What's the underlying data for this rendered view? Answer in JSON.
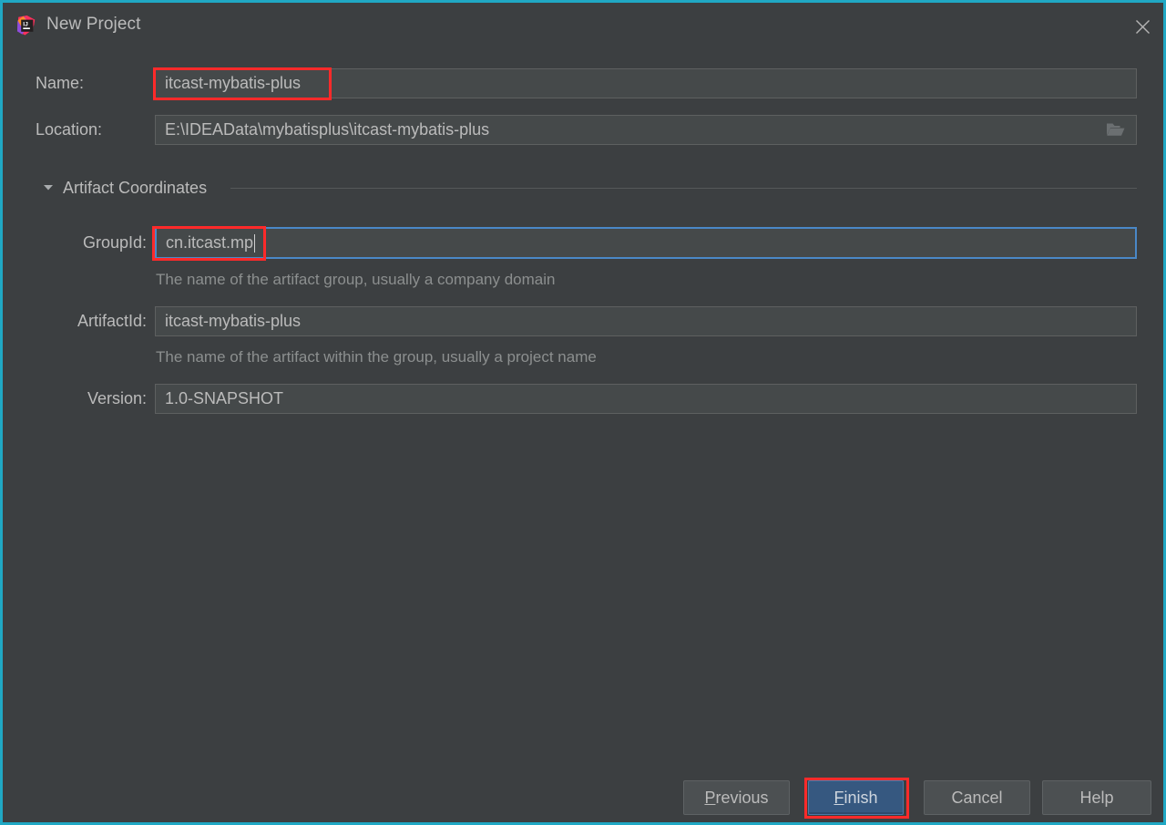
{
  "window": {
    "title": "New Project",
    "app_icon": "intellij-idea-logo",
    "close_icon": "close-icon",
    "border_color": "#20a8c4",
    "background_color": "#3c3f41"
  },
  "form": {
    "name": {
      "label": "Name:",
      "value": "itcast-mybatis-plus",
      "annotated": true
    },
    "location": {
      "label": "Location:",
      "value": "E:\\IDEAData\\mybatisplus\\itcast-mybatis-plus",
      "browse_icon": "folder-icon"
    },
    "section": {
      "label": "Artifact Coordinates",
      "expanded": true,
      "toggle_icon": "chevron-down-icon"
    },
    "group_id": {
      "label": "GroupId:",
      "value": "cn.itcast.mp",
      "hint": "The name of the artifact group, usually a company domain",
      "focused": true,
      "annotated": true
    },
    "artifact_id": {
      "label": "ArtifactId:",
      "value": "itcast-mybatis-plus",
      "hint": "The name of the artifact within the group, usually a project name"
    },
    "version": {
      "label": "Version:",
      "value": "1.0-SNAPSHOT"
    }
  },
  "footer": {
    "previous": {
      "label": "Previous",
      "mnemonic": "P",
      "rest": "revious"
    },
    "finish": {
      "label": "Finish",
      "mnemonic": "F",
      "rest": "inish",
      "default": true,
      "annotated": true,
      "color": "#365880"
    },
    "cancel": {
      "label": "Cancel"
    },
    "help": {
      "label": "Help"
    }
  },
  "annotation": {
    "color": "#ff2a2a"
  }
}
